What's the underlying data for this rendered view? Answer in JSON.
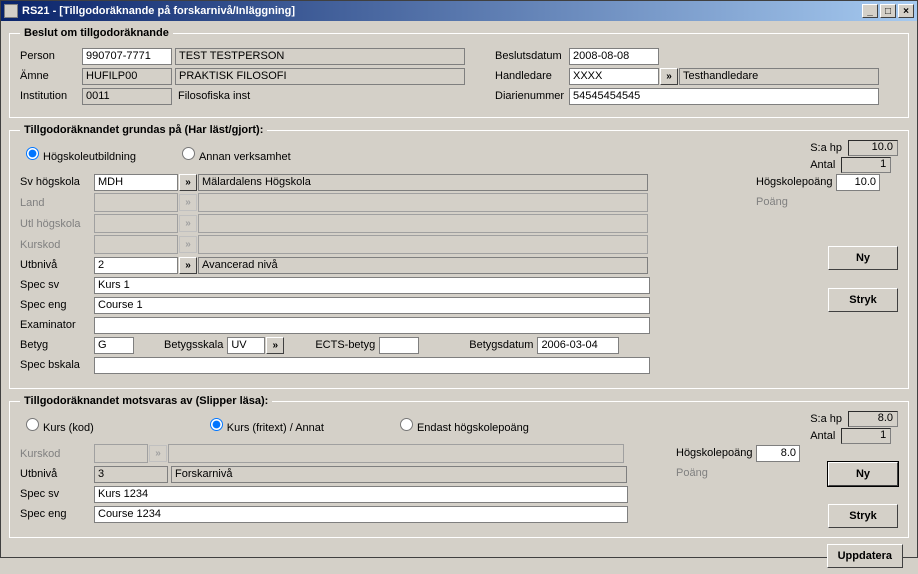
{
  "window": {
    "title": "RS21 - [Tillgodoräknande på forskarnivå/Inläggning]"
  },
  "section1": {
    "legend": "Beslut om tillgodoräknande",
    "person_label": "Person",
    "person_id": "990707-7771",
    "person_name": "TEST TESTPERSON",
    "amne_label": "Ämne",
    "amne_code": "HUFILP00",
    "amne_name": "PRAKTISK FILOSOFI",
    "inst_label": "Institution",
    "inst_code": "0011",
    "inst_name": "Filosofiska inst",
    "beslutsdatum_label": "Beslutsdatum",
    "beslutsdatum": "2008-08-08",
    "handledare_label": "Handledare",
    "handledare_code": "XXXX",
    "handledare_name": "Testhandledare",
    "diarienr_label": "Diarienummer",
    "diarienr": "54545454545"
  },
  "section2": {
    "legend": "Tillgodoräknandet grundas på (Har läst/gjort):",
    "radio_hogsk": "Högskoleutbildning",
    "radio_annan": "Annan verksamhet",
    "sum_hp_label": "S:a hp",
    "sum_hp": "10.0",
    "antal_label": "Antal",
    "antal": "1",
    "svhog_label": "Sv högskola",
    "svhog_code": "MDH",
    "svhog_name": "Mälardalens Högskola",
    "land_label": "Land",
    "land_code": "",
    "land_name": "",
    "utlhog_label": "Utl högskola",
    "utlhog_code": "",
    "utlhog_name": "",
    "kurskod_label": "Kurskod",
    "kurskod_code": "",
    "kurskod_name": "",
    "utbniva_label": "Utbnivå",
    "utbniva_code": "2",
    "utbniva_name": "Avancerad nivå",
    "specsv_label": "Spec sv",
    "specsv": "Kurs 1",
    "speceng_label": "Spec eng",
    "speceng": "Course 1",
    "examinator_label": "Examinator",
    "examinator": "",
    "betyg_label": "Betyg",
    "betyg": "G",
    "betygsskala_label": "Betygsskala",
    "betygsskala": "UV",
    "ectsbetyg_label": "ECTS-betyg",
    "ectsbetyg": "",
    "betygsdatum_label": "Betygsdatum",
    "betygsdatum": "2006-03-04",
    "specbskala_label": "Spec bskala",
    "specbskala": "",
    "hp_label": "Högskolepoäng",
    "hp": "10.0",
    "poang_label": "Poäng",
    "btn_ny": "Ny",
    "btn_stryk": "Stryk"
  },
  "section3": {
    "legend": "Tillgodoräknandet motsvaras av (Slipper läsa):",
    "radio_kurs": "Kurs (kod)",
    "radio_fritext": "Kurs (fritext) / Annat",
    "radio_endast": "Endast högskolepoäng",
    "sum_hp_label": "S:a hp",
    "sum_hp": "8.0",
    "antal_label": "Antal",
    "antal": "1",
    "kurskod_label": "Kurskod",
    "kurskod_code": "",
    "kurskod_name": "",
    "utbniva_label": "Utbnivå",
    "utbniva_code": "3",
    "utbniva_name": "Forskarnivå",
    "specsv_label": "Spec sv",
    "specsv": "Kurs 1234",
    "speceng_label": "Spec eng",
    "speceng": "Course 1234",
    "hp_label": "Högskolepoäng",
    "hp": "8.0",
    "poang_label": "Poäng",
    "btn_ny": "Ny",
    "btn_stryk": "Stryk"
  },
  "footer": {
    "btn_uppdatera": "Uppdatera"
  }
}
